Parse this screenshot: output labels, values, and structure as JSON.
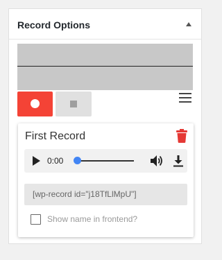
{
  "panel": {
    "title": "Record Options",
    "collapse_icon": "triangle-up-icon"
  },
  "recorder": {
    "record_icon": "record-dot-icon",
    "stop_icon": "stop-square-icon",
    "menu_icon": "hamburger-menu-icon"
  },
  "record": {
    "title": "First Record",
    "delete_icon": "trash-icon",
    "player": {
      "time": "0:00",
      "progress": 0,
      "play_icon": "play-icon",
      "volume_icon": "volume-icon",
      "download_icon": "download-icon"
    },
    "shortcode": "[wp-record id=\"j18TfLlMpU\"]",
    "show_name_label": "Show name in frontend?",
    "show_name_checked": false
  },
  "colors": {
    "record_red": "#f44336",
    "seek_blue": "#4285f4",
    "trash_red": "#e53935"
  }
}
